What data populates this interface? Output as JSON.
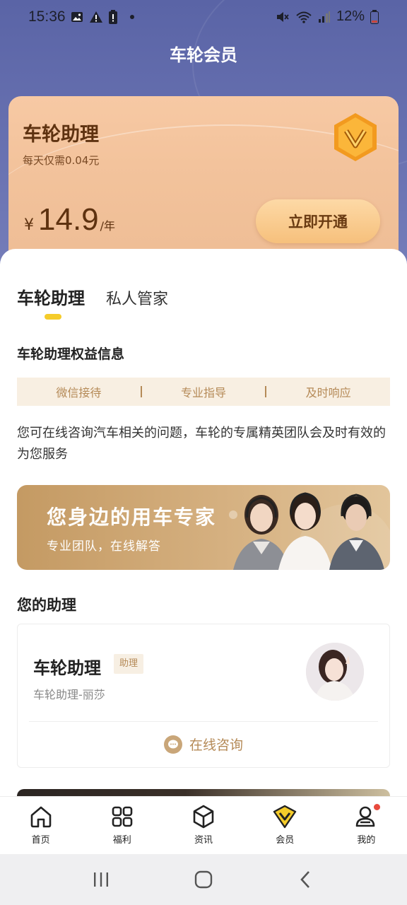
{
  "status_bar": {
    "time": "15:36",
    "battery": "12%"
  },
  "page": {
    "title": "车轮会员"
  },
  "member_card": {
    "title": "车轮助理",
    "subtitle": "每天仅需0.04元",
    "currency": "¥",
    "price": "14.9",
    "unit": "/年",
    "button": "立即开通"
  },
  "tabs": [
    {
      "label": "车轮助理",
      "active": true
    },
    {
      "label": "私人管家",
      "active": false
    }
  ],
  "benefits": {
    "title": "车轮助理权益信息",
    "items": [
      "微信接待",
      "专业指导",
      "及时响应"
    ],
    "description": "您可在线咨询汽车相关的问题，车轮的专属精英团队会及时有效的为您服务"
  },
  "banner": {
    "title": "您身边的用车专家",
    "subtitle": "专业团队，在线解答"
  },
  "assistant": {
    "section_title": "您的助理",
    "name": "车轮助理",
    "tag": "助理",
    "sub": "车轮助理-丽莎",
    "consult_label": "在线咨询"
  },
  "tabbar": [
    {
      "label": "首页",
      "icon": "home-icon"
    },
    {
      "label": "福利",
      "icon": "grid-icon"
    },
    {
      "label": "资讯",
      "icon": "cube-icon"
    },
    {
      "label": "会员",
      "icon": "vip-icon"
    },
    {
      "label": "我的",
      "icon": "user-icon"
    }
  ],
  "colors": {
    "accent": "#f5cc2a",
    "gold": "#b58a57",
    "header": "#5a64a6"
  }
}
